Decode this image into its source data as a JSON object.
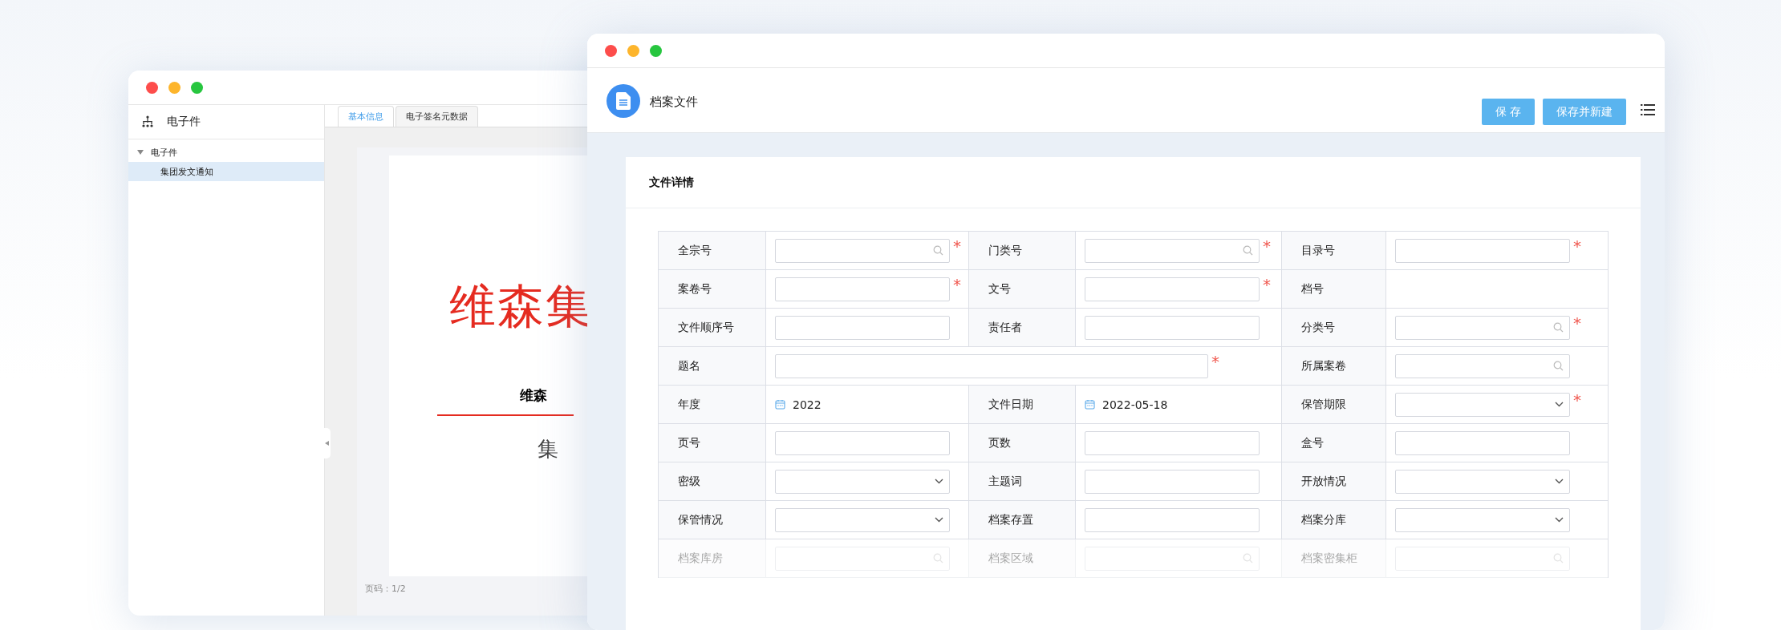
{
  "back_window": {
    "sidebar": {
      "title": "电子件",
      "tree": [
        {
          "label": "电子件",
          "expanded": true,
          "children": [
            {
              "label": "集团发文通知",
              "selected": true
            }
          ]
        }
      ]
    },
    "tabs": [
      {
        "label": "基本信息",
        "selected": true
      },
      {
        "label": "电子签名元数据",
        "selected": false
      }
    ],
    "document": {
      "title": "维森集",
      "subtitle": "维森",
      "line_2": "集"
    },
    "pager": "页码：1/2"
  },
  "front_window": {
    "title": "档案文件",
    "buttons": [
      "保 存",
      "保存并新建"
    ],
    "card_title": "文件详情",
    "rows": [
      [
        {
          "label": "全宗号",
          "kind": "search",
          "marker": "*"
        },
        {
          "label": "门类号",
          "kind": "search",
          "marker": "*"
        },
        {
          "label": "目录号",
          "kind": "text",
          "marker": "*"
        }
      ],
      [
        {
          "label": "案卷号",
          "kind": "text",
          "marker": "*"
        },
        {
          "label": "文号",
          "kind": "text",
          "marker": "*"
        },
        {
          "label": "档号",
          "kind": "none"
        }
      ],
      [
        {
          "label": "文件顺序号",
          "kind": "text"
        },
        {
          "label": "责任者",
          "kind": "text"
        },
        {
          "label": "分类号",
          "kind": "search",
          "marker": "*"
        }
      ],
      [
        {
          "label": "题名",
          "kind": "wide",
          "marker": "*"
        },
        "",
        {
          "label": "所属案卷",
          "kind": "search"
        }
      ],
      [
        {
          "label": "年度",
          "kind": "date",
          "value": "2022"
        },
        {
          "label": "文件日期",
          "kind": "date",
          "value": "2022-05-18"
        },
        {
          "label": "保管期限",
          "kind": "select",
          "marker": "*"
        }
      ],
      [
        {
          "label": "页号",
          "kind": "text"
        },
        {
          "label": "页数",
          "kind": "text"
        },
        {
          "label": "盒号",
          "kind": "text"
        }
      ],
      [
        {
          "label": "密级",
          "kind": "select"
        },
        {
          "label": "主题词",
          "kind": "text"
        },
        {
          "label": "开放情况",
          "kind": "select"
        }
      ],
      [
        {
          "label": "保管情况",
          "kind": "select"
        },
        {
          "label": "档案存置",
          "kind": "text"
        },
        {
          "label": "档案分库",
          "kind": "select"
        }
      ],
      [
        {
          "label": "档案库房",
          "kind": "search"
        },
        {
          "label": "档案区域",
          "kind": "search"
        },
        {
          "label": "档案密集柜",
          "kind": "search"
        }
      ]
    ]
  }
}
